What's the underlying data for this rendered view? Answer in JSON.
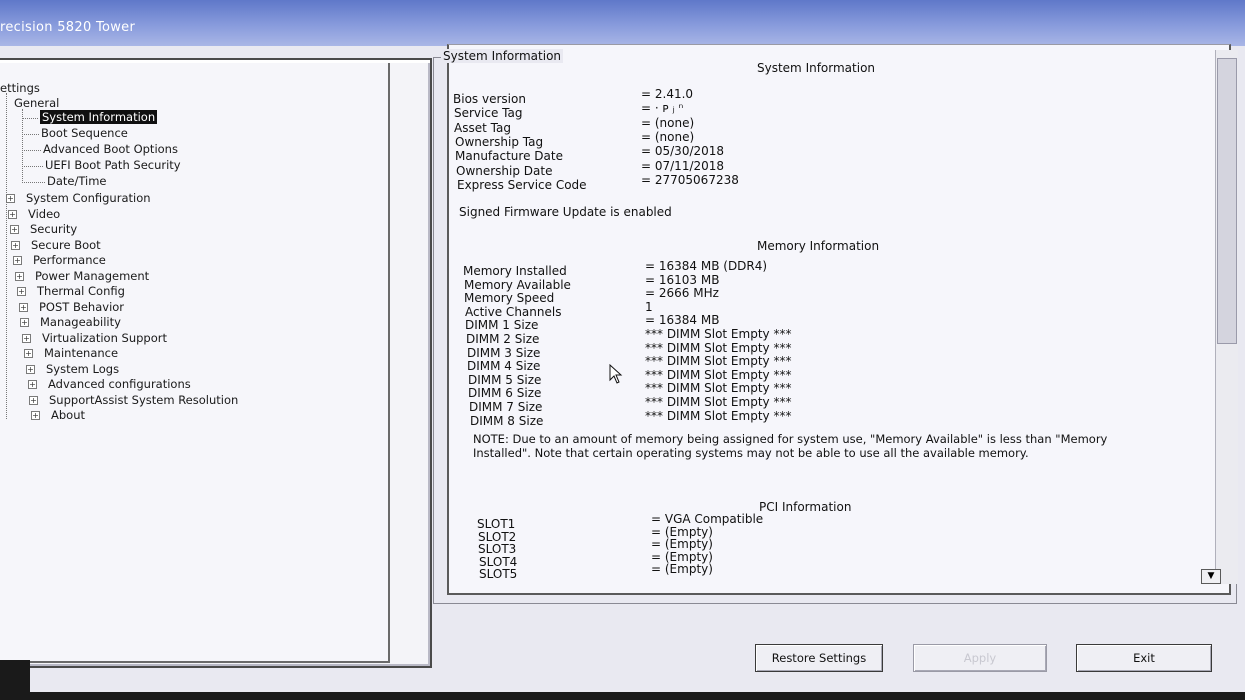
{
  "window": {
    "title": "recision 5820 Tower"
  },
  "tree": {
    "root": "ettings",
    "general": "General",
    "general_children": [
      {
        "label": "System Information",
        "selected": true
      },
      {
        "label": "Boot Sequence"
      },
      {
        "label": "Advanced Boot Options"
      },
      {
        "label": "UEFI Boot Path Security"
      },
      {
        "label": "Date/Time"
      }
    ],
    "sections": [
      "System Configuration",
      "Video",
      "Security",
      "Secure Boot",
      "Performance",
      "Power Management",
      "Thermal Config",
      "POST Behavior",
      "Manageability",
      "Virtualization Support",
      "Maintenance",
      "System Logs",
      "Advanced configurations",
      "SupportAssist System Resolution",
      "About"
    ],
    "expander_symbol": "+"
  },
  "content": {
    "group_label": "System Information",
    "system_title": "System Information",
    "system_rows": [
      {
        "label": "Bios version",
        "value": "= 2.41.0"
      },
      {
        "label": "Service Tag",
        "value": "= · ᴘ ⱼ ⁿ"
      },
      {
        "label": "Asset Tag",
        "value": "= (none)"
      },
      {
        "label": "Ownership Tag",
        "value": "= (none)"
      },
      {
        "label": "Manufacture Date",
        "value": "= 05/30/2018"
      },
      {
        "label": "Ownership Date",
        "value": "= 07/11/2018"
      },
      {
        "label": "Express Service Code",
        "value": "= 27705067238"
      }
    ],
    "firmware_note": "Signed Firmware Update is enabled",
    "memory_title": "Memory Information",
    "memory_rows": [
      {
        "label": "Memory Installed",
        "value": "= 16384 MB (DDR4)"
      },
      {
        "label": "Memory Available",
        "value": "= 16103 MB"
      },
      {
        "label": "Memory Speed",
        "value": "= 2666 MHz"
      },
      {
        "label": "Active Channels",
        "value": "1"
      },
      {
        "label": "DIMM 1 Size",
        "value": "= 16384 MB"
      },
      {
        "label": "DIMM 2 Size",
        "value": "*** DIMM Slot Empty ***"
      },
      {
        "label": "DIMM 3 Size",
        "value": "*** DIMM Slot Empty ***"
      },
      {
        "label": "DIMM 4 Size",
        "value": "*** DIMM Slot Empty ***"
      },
      {
        "label": "DIMM 5 Size",
        "value": "*** DIMM Slot Empty ***"
      },
      {
        "label": "DIMM 6 Size",
        "value": "*** DIMM Slot Empty ***"
      },
      {
        "label": "DIMM 7 Size",
        "value": "*** DIMM Slot Empty ***"
      },
      {
        "label": "DIMM 8 Size",
        "value": "*** DIMM Slot Empty ***"
      }
    ],
    "memory_note": "NOTE: Due to an amount of memory being assigned for system use, \"Memory Available\" is less than \"Memory Installed\". Note that certain operating systems may not be able to use all the available memory.",
    "pci_title": "PCI Information",
    "pci_rows": [
      {
        "label": "SLOT1",
        "value": "= VGA Compatible"
      },
      {
        "label": "SLOT2",
        "value": "= (Empty)"
      },
      {
        "label": "SLOT3",
        "value": "= (Empty)"
      },
      {
        "label": "SLOT4",
        "value": "= (Empty)"
      },
      {
        "label": "SLOT5",
        "value": "= (Empty)"
      }
    ]
  },
  "buttons": {
    "restore": "Restore Settings",
    "apply": "Apply",
    "exit": "Exit"
  },
  "icons": {
    "scroll_down": "▼",
    "cursor": "mouse-pointer-icon"
  }
}
